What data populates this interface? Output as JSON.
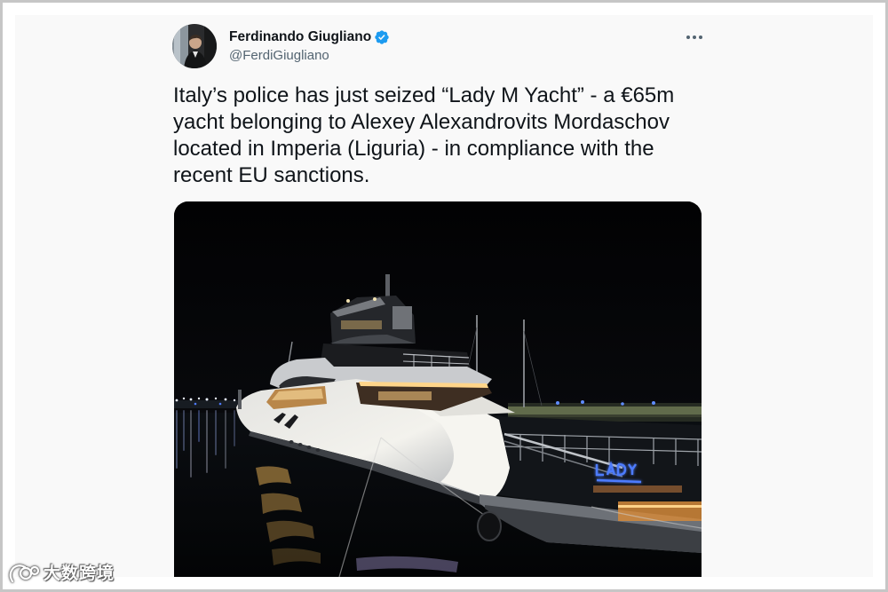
{
  "tweet": {
    "author": {
      "name": "Ferdinando Giugliano",
      "handle": "@FerdiGiugliano",
      "verified": true,
      "avatar_icon": "avatar-photo",
      "verified_icon": "verified-badge-icon"
    },
    "more_icon": "more-dots-icon",
    "text": "Italy’s police has just seized “Lady M Yacht” - a €65m yacht belonging to Alexey Alexandrovits Mordaschov located in Imperia (Liguria) - in compliance with the recent EU sanctions.",
    "media": {
      "type": "photo"
    }
  },
  "watermark": {
    "text": "大数跨境",
    "logo_icon": "watermark-logo-icon"
  },
  "colors": {
    "verified": "#1d9bf0",
    "primary_text": "#0f1419",
    "secondary_text": "#536471",
    "frame_border": "#c6c6c6",
    "panel_background": "#f9f9f9"
  }
}
